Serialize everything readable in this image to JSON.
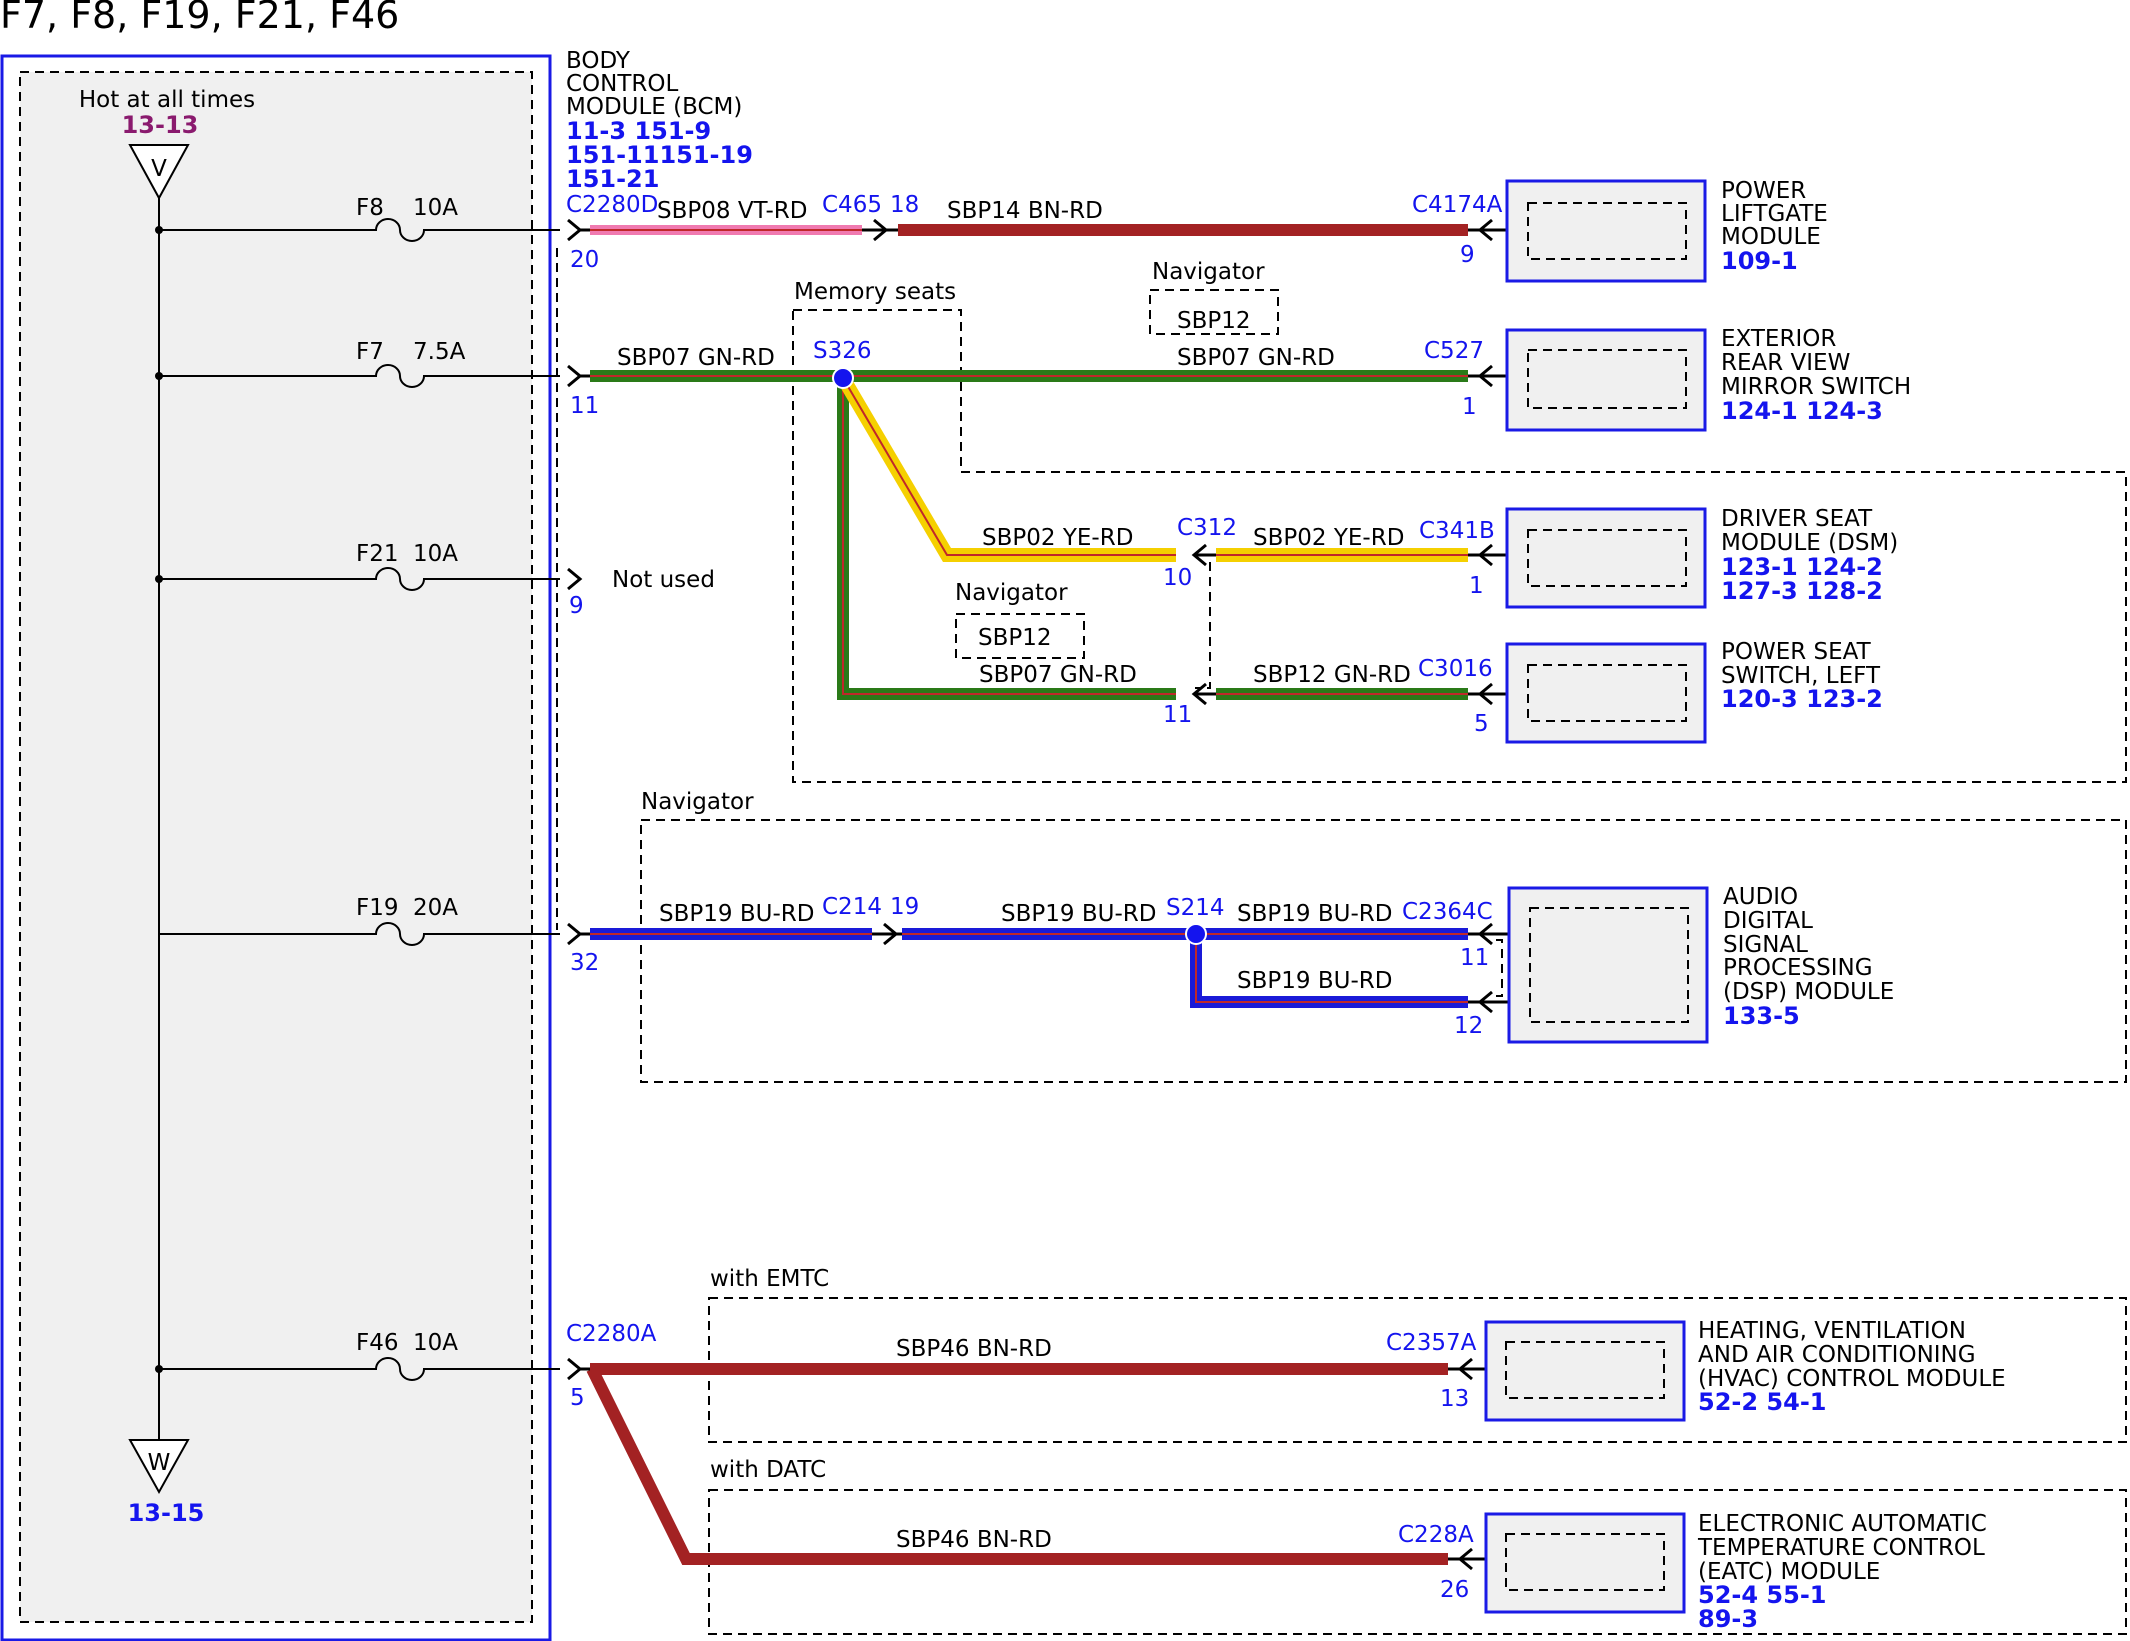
{
  "title": "F7, F8, F19, F21, F46",
  "fuse_box": {
    "hot_label": "Hot at all times",
    "hot_ref": "13-13",
    "top_symbol": "V",
    "bottom_symbol": "W",
    "bottom_ref": "13-15"
  },
  "fuses": [
    {
      "name": "F8",
      "rating": "10A"
    },
    {
      "name": "F7",
      "rating": "7.5A"
    },
    {
      "name": "F21",
      "rating": "10A"
    },
    {
      "name": "F19",
      "rating": "20A"
    },
    {
      "name": "F46",
      "rating": "10A"
    }
  ],
  "bcm": {
    "name": [
      "BODY",
      "CONTROL",
      "MODULE (BCM)"
    ],
    "refs": [
      "11-3  151-9",
      "151-11151-19",
      "151-21"
    ]
  },
  "connectors": {
    "c2280d": "C2280D",
    "c465": "C465",
    "c4174a": "C4174A",
    "s326": "S326",
    "c527": "C527",
    "c312": "C312",
    "c341b": "C341B",
    "c3016": "C3016",
    "c214": "C214",
    "s214": "S214",
    "c2364c": "C2364C",
    "c2280a": "C2280A",
    "c2357a": "C2357A",
    "c228a": "C228A"
  },
  "pins": {
    "p20": "20",
    "p18": "18",
    "p9a": "9",
    "p11a": "11",
    "p1a": "1",
    "p9b": "9",
    "p10": "10",
    "p1b": "1",
    "p11b": "11",
    "p5a": "5",
    "p32": "32",
    "p19": "19",
    "p11c": "11",
    "p12": "12",
    "p5b": "5",
    "p13": "13",
    "p26": "26"
  },
  "wires": {
    "sbp08": "SBP08  VT-RD",
    "sbp14": "SBP14  BN-RD",
    "sbp07a": "SBP07  GN-RD",
    "sbp07b": "SBP07  GN-RD",
    "sbp02a": "SBP02  YE-RD",
    "sbp02b": "SBP02  YE-RD",
    "sbp07c": "SBP07  GN-RD",
    "sbp12": "SBP12  GN-RD",
    "sbp19a": "SBP19  BU-RD",
    "sbp19b": "SBP19  BU-RD",
    "sbp19c": "SBP19  BU-RD",
    "sbp19d": "SBP19  BU-RD",
    "sbp46a": "SBP46  BN-RD",
    "sbp46b": "SBP46  BN-RD"
  },
  "options": {
    "memory_seats": "Memory seats",
    "navigator_1": "Navigator",
    "navigator_1_circuit": "SBP12",
    "navigator_2": "Navigator",
    "navigator_2_circuit": "SBP12",
    "navigator_3": "Navigator",
    "with_emtc": "with EMTC",
    "with_datc": "with DATC"
  },
  "not_used": "Not used",
  "components": [
    {
      "lines": [
        "POWER",
        "LIFTGATE",
        "MODULE"
      ],
      "refs": "109-1"
    },
    {
      "lines": [
        "EXTERIOR",
        "REAR VIEW",
        "MIRROR SWITCH"
      ],
      "refs": "124-1 124-3"
    },
    {
      "lines": [
        "DRIVER SEAT",
        "MODULE (DSM)"
      ],
      "refs": [
        "123-1 124-2",
        "127-3 128-2"
      ]
    },
    {
      "lines": [
        "POWER SEAT",
        "SWITCH, LEFT"
      ],
      "refs": "120-3 123-2"
    },
    {
      "lines": [
        "AUDIO",
        "DIGITAL",
        "SIGNAL",
        "PROCESSING",
        "(DSP) MODULE"
      ],
      "refs": "133-5"
    },
    {
      "lines": [
        "HEATING, VENTILATION",
        "AND AIR CONDITIONING",
        "(HVAC) CONTROL MODULE"
      ],
      "refs": "52-2  54-1"
    },
    {
      "lines": [
        "ELECTRONIC AUTOMATIC",
        "TEMPERATURE CONTROL",
        "(EATC) MODULE"
      ],
      "refs": [
        "52-4  55-1",
        "89-3"
      ]
    }
  ],
  "colors": {
    "outline_blue": "#1a1ae6",
    "label_blue": "#1414ee",
    "ref_purple": "#8a1a6e",
    "module_fill": "#f0f0f0",
    "wire_red": "#c0282a",
    "wire_green": "#2a7a18",
    "wire_yellow": "#f5d000",
    "wire_blue": "#1a1ad8",
    "wire_pink": "#f07ab0"
  }
}
